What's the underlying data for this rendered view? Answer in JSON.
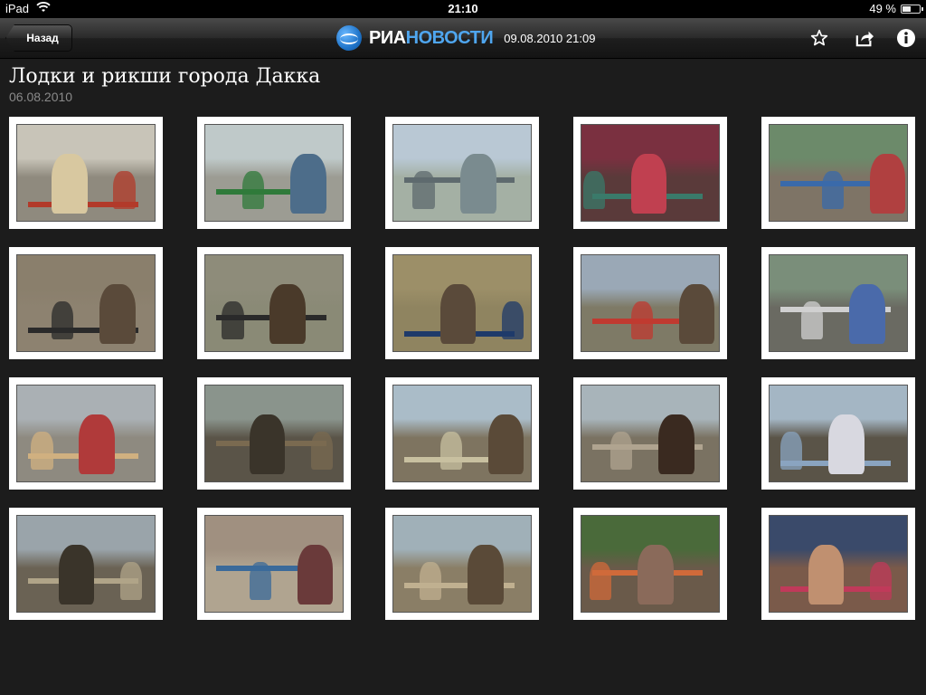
{
  "status_bar": {
    "device": "iPad",
    "time": "21:10",
    "battery": "49 %",
    "battery_level": 0.49,
    "icons": [
      "wifi-icon",
      "battery-icon"
    ]
  },
  "nav": {
    "back_label": "Назад",
    "brand_ria": "РИА",
    "brand_novosti": "НОВОСТИ",
    "datetime": "09.08.2010 21:09",
    "icons": [
      "star-icon",
      "share-icon",
      "info-icon"
    ]
  },
  "article": {
    "title": "Лодки и рикши города Дакка",
    "date": "06.08.2010"
  },
  "gallery": {
    "thumbnails": [
      {
        "row": 0,
        "col": 0,
        "sky": "#c8c4b8",
        "ground": "#8f8a7e",
        "subject": "#d8c8a0",
        "accent": "#b23a2a"
      },
      {
        "row": 0,
        "col": 1,
        "sky": "#bfc9c9",
        "ground": "#9c9c93",
        "subject": "#4d6d8a",
        "accent": "#2f7a3a"
      },
      {
        "row": 0,
        "col": 2,
        "sky": "#b9c8d4",
        "ground": "#a4b0a4",
        "subject": "#7a8b8f",
        "accent": "#5e6a6e"
      },
      {
        "row": 0,
        "col": 3,
        "sky": "#7a3040",
        "ground": "#5a3a3a",
        "subject": "#c04050",
        "accent": "#3a7a6a"
      },
      {
        "row": 0,
        "col": 4,
        "sky": "#6c8a6a",
        "ground": "#7e7466",
        "subject": "#b04040",
        "accent": "#3a6aaa"
      },
      {
        "row": 1,
        "col": 0,
        "sky": "#8a7f6c",
        "ground": "#8d8270",
        "subject": "#5a4a3a",
        "accent": "#2a2a2a"
      },
      {
        "row": 1,
        "col": 1,
        "sky": "#8e8c7a",
        "ground": "#8a8a76",
        "subject": "#4a3a2a",
        "accent": "#2a2a2a"
      },
      {
        "row": 1,
        "col": 2,
        "sky": "#9c8f68",
        "ground": "#8f8460",
        "subject": "#5a4a3a",
        "accent": "#1e3a6a"
      },
      {
        "row": 1,
        "col": 3,
        "sky": "#9aa8b6",
        "ground": "#7e7a66",
        "subject": "#5a4a3a",
        "accent": "#c03a30"
      },
      {
        "row": 1,
        "col": 4,
        "sky": "#7a8e7a",
        "ground": "#6a6a62",
        "subject": "#4a6aaa",
        "accent": "#d0d0d0"
      },
      {
        "row": 2,
        "col": 0,
        "sky": "#aab0b4",
        "ground": "#8e8a80",
        "subject": "#b03a3a",
        "accent": "#d0b080"
      },
      {
        "row": 2,
        "col": 1,
        "sky": "#8a948c",
        "ground": "#5a5448",
        "subject": "#3a342a",
        "accent": "#7a6a50"
      },
      {
        "row": 2,
        "col": 2,
        "sky": "#aabcc8",
        "ground": "#7e7460",
        "subject": "#5a4a38",
        "accent": "#c8c0a0"
      },
      {
        "row": 2,
        "col": 3,
        "sky": "#a8b4ba",
        "ground": "#7a7262",
        "subject": "#3a2a20",
        "accent": "#b0a490"
      },
      {
        "row": 2,
        "col": 4,
        "sky": "#a4b6c4",
        "ground": "#5a5448",
        "subject": "#d8d8e0",
        "accent": "#8aa4c0"
      },
      {
        "row": 3,
        "col": 0,
        "sky": "#9aa4aa",
        "ground": "#6a6254",
        "subject": "#3a342a",
        "accent": "#b0a488"
      },
      {
        "row": 3,
        "col": 1,
        "sky": "#a09080",
        "ground": "#b0a490",
        "subject": "#6a3a3a",
        "accent": "#3a6a9a"
      },
      {
        "row": 3,
        "col": 2,
        "sky": "#a0b0b8",
        "ground": "#8a7e66",
        "subject": "#5a4a38",
        "accent": "#c0b090"
      },
      {
        "row": 3,
        "col": 3,
        "sky": "#4a6a3a",
        "ground": "#6a5a4a",
        "subject": "#8a6a5a",
        "accent": "#d06a3a"
      },
      {
        "row": 3,
        "col": 4,
        "sky": "#3a4a6a",
        "ground": "#7a5a4a",
        "subject": "#c09070",
        "accent": "#c03a5a"
      }
    ]
  }
}
